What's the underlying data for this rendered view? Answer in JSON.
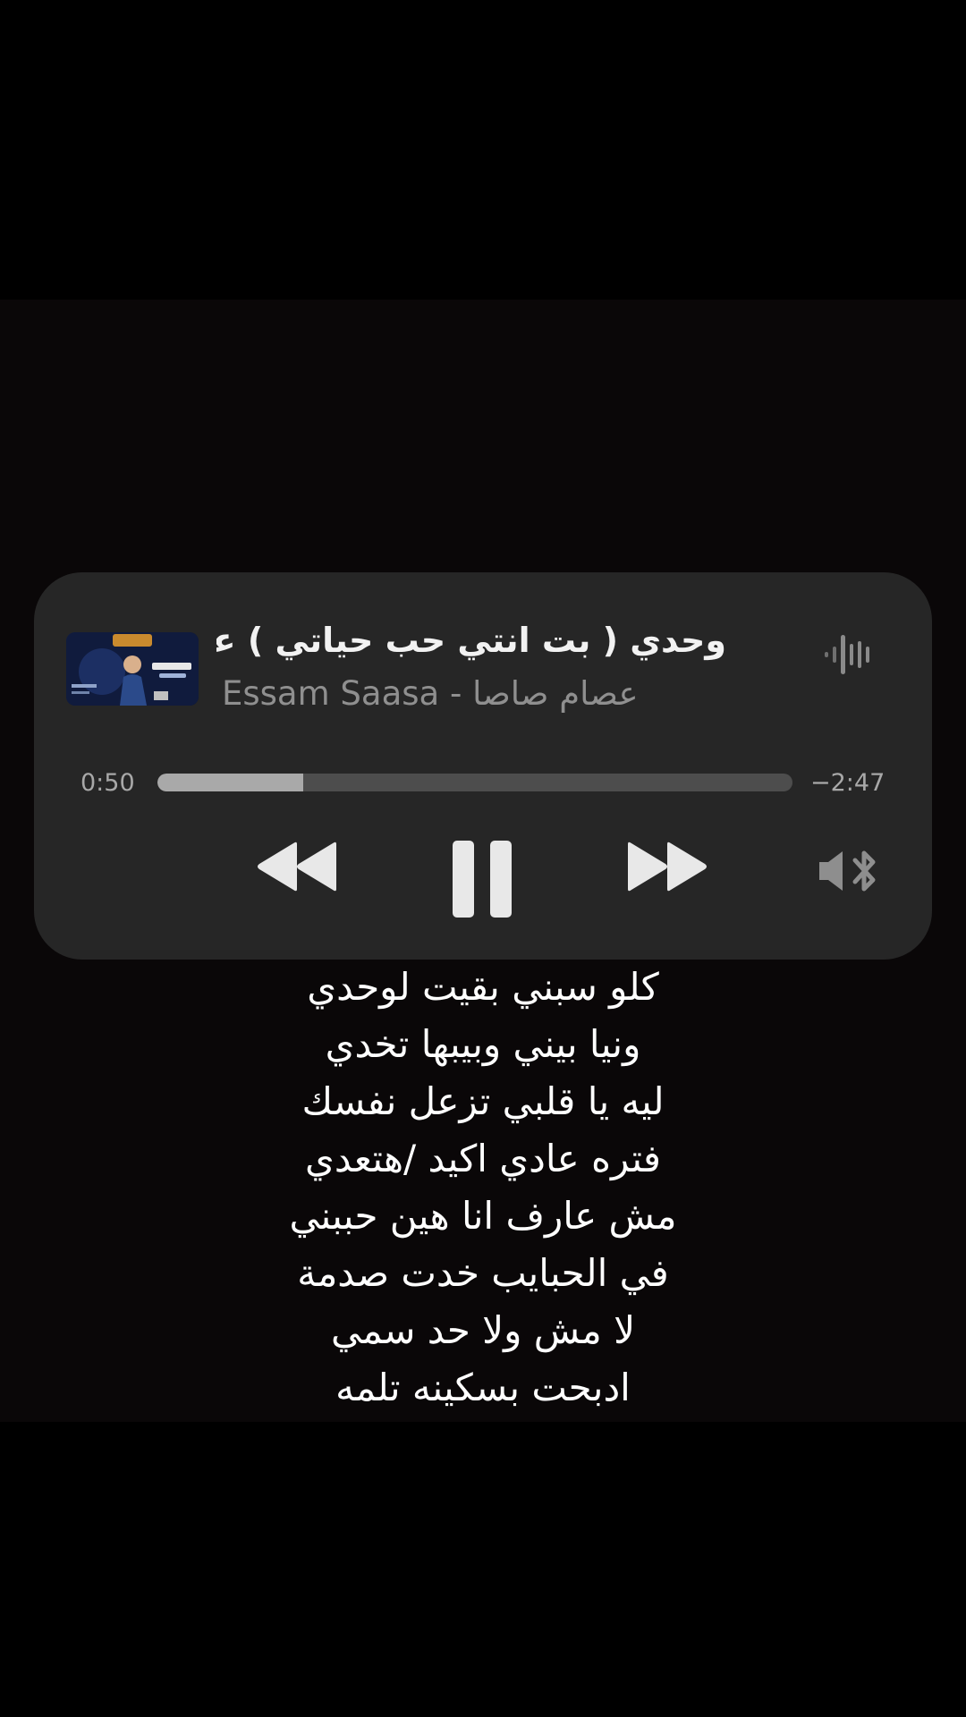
{
  "now_playing": {
    "title": "وحدي ( بت انتي حب حياتي ) عصام صاصا",
    "subtitle": "Essam Saasa - عصام صاصا",
    "artwork_icon": "album-artwork",
    "status_icon": "audio-waveform-icon"
  },
  "playback": {
    "elapsed": "0:50",
    "remaining": "−2:47",
    "progress_fraction": 0.23
  },
  "controls": {
    "rewind_icon": "rewind-icon",
    "pause_icon": "pause-icon",
    "forward_icon": "fast-forward-icon",
    "audio_route_icon": "speaker-bluetooth-icon"
  },
  "lyrics": [
    "كلو سبني بقيت لوحدي",
    "ونيا بيني وبيبها تخدي",
    "ليه يا قلبي تزعل نفسك",
    "فتره عادي اكيد /هتعدي",
    "مش عارف انا هين حببني",
    "في الحبايب خدت صدمة",
    "لا مش ولا حد سمي",
    "ادبحت بسكينه تلمه"
  ],
  "colors": {
    "background": "#000000",
    "panel": "#262626",
    "primary_text": "#f2f2f2",
    "secondary_text": "#8f8f8f",
    "track": "#4d4d4d",
    "track_fill": "#a9a9a9"
  }
}
